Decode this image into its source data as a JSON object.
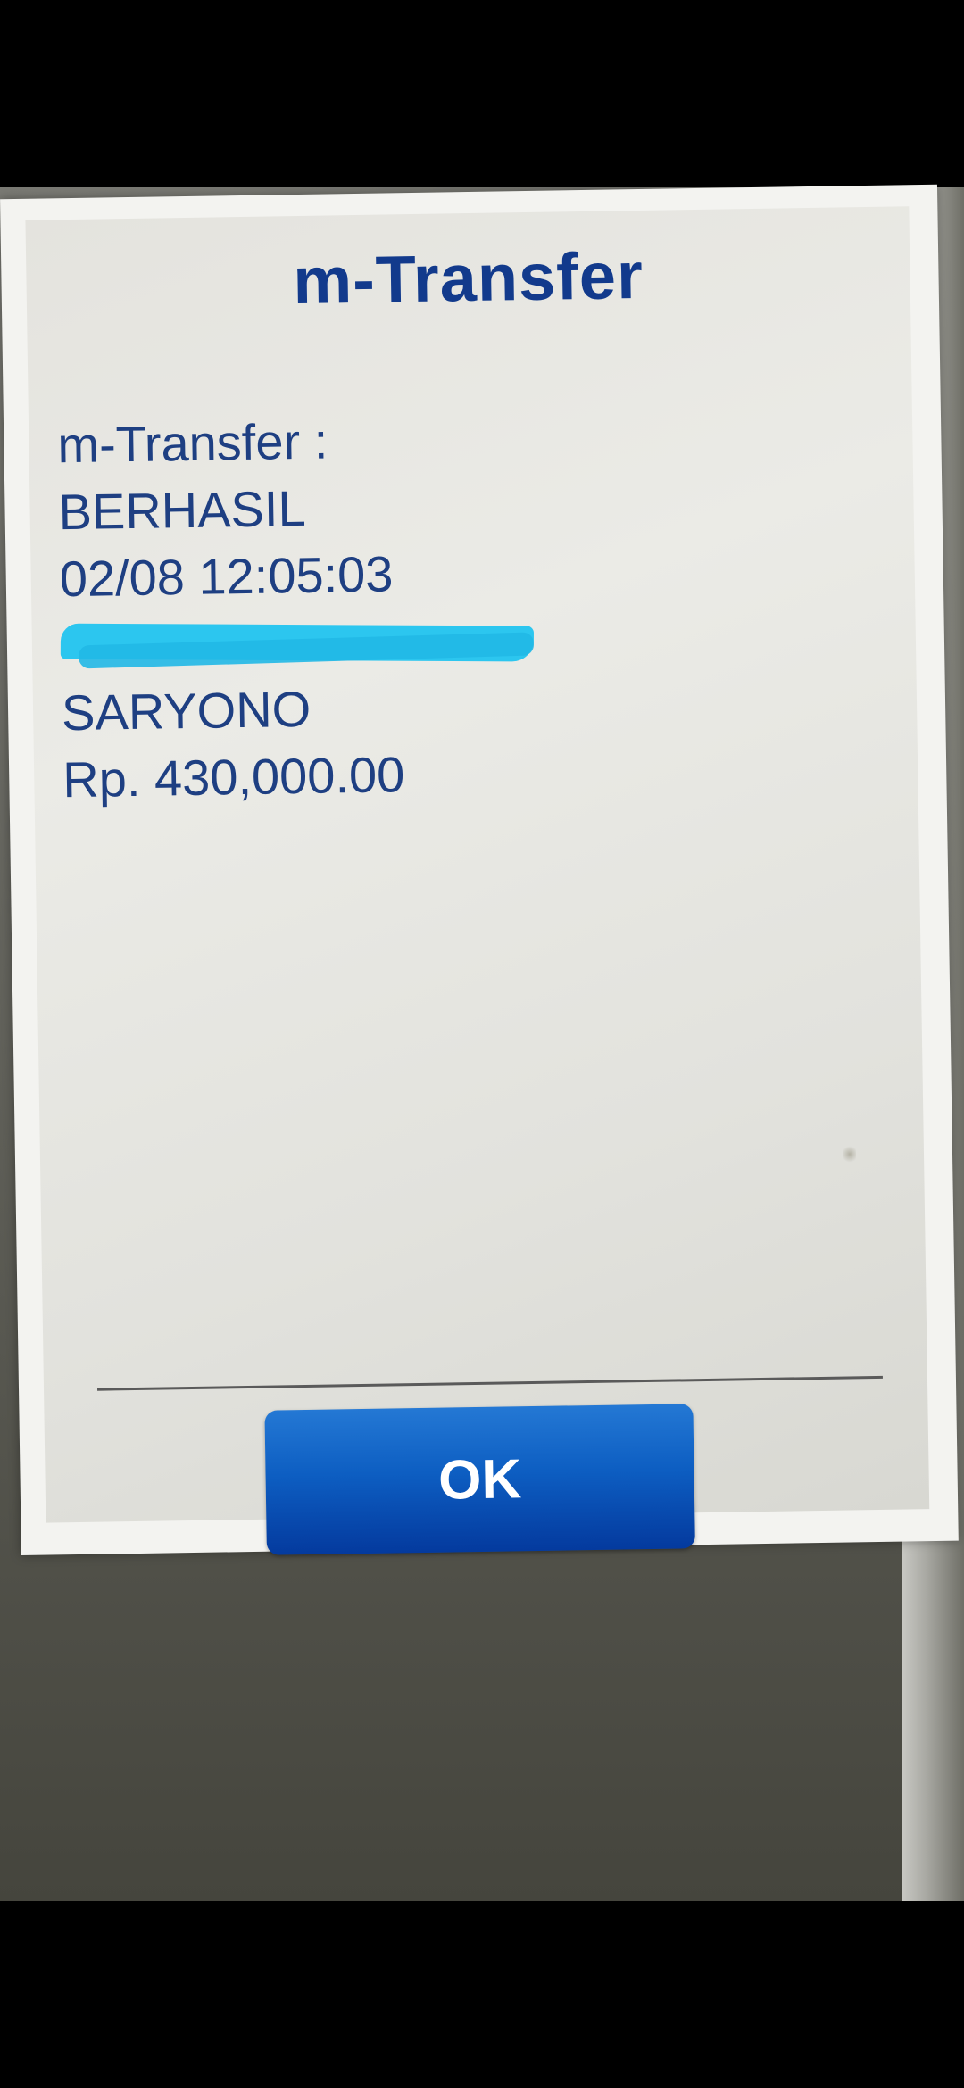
{
  "dialog": {
    "title": "m-Transfer",
    "lines": {
      "label": "m-Transfer :",
      "status": "BERHASIL",
      "datetime": "02/08 12:05:03",
      "recipient": "SARYONO",
      "amount": "Rp. 430,000.00"
    },
    "ok_label": "OK"
  },
  "colors": {
    "title": "#123a8c",
    "text": "#1e3f82",
    "button": "#0d5ec2",
    "redaction": "#2cc6ef"
  }
}
